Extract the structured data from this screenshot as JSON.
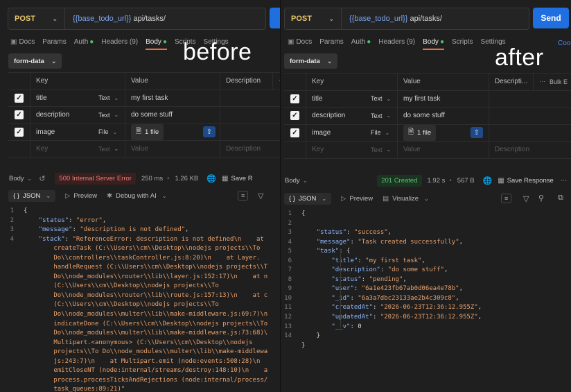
{
  "left": {
    "method": "POST",
    "url_var": "{{base_todo_url}}",
    "url_path": " api/tasks/",
    "send_label": "S",
    "tabs": [
      "Docs",
      "Params",
      "Auth",
      "Headers (9)",
      "Body",
      "Scripts",
      "Settings"
    ],
    "body_mode": "form-data",
    "table_headers": [
      "Key",
      "Value",
      "Description"
    ],
    "rows": [
      {
        "key": "title",
        "type": "Text",
        "value": "my first task"
      },
      {
        "key": "description",
        "type": "Text",
        "value": "do some stuff"
      },
      {
        "key": "image",
        "type": "File",
        "value": "1 file"
      }
    ],
    "placeholder": {
      "key": "Key",
      "type": "Text",
      "value": "Value",
      "desc": "Description"
    },
    "response": {
      "label": "Body",
      "status": "500 Internal Server Error",
      "time": "250 ms",
      "size": "1.26 KB",
      "save": "Save R"
    },
    "view": {
      "format": "JSON",
      "preview": "Preview",
      "extra": "Debug with AI"
    },
    "code": [
      [
        [
          "t",
          "{"
        ]
      ],
      [
        [
          "t",
          "    "
        ],
        [
          "k",
          "\"status\""
        ],
        [
          "t",
          ": "
        ],
        [
          "s",
          "\"error\""
        ],
        [
          "t",
          ","
        ]
      ],
      [
        [
          "t",
          "    "
        ],
        [
          "k",
          "\"message\""
        ],
        [
          "t",
          ": "
        ],
        [
          "s",
          "\"description is not defined\""
        ],
        [
          "t",
          ","
        ]
      ],
      [
        [
          "t",
          "    "
        ],
        [
          "k",
          "\"stack\""
        ],
        [
          "t",
          ": "
        ],
        [
          "s",
          "\"ReferenceError: description is not defined\\n    at"
        ]
      ],
      [
        [
          "s",
          "        createTask (C:\\\\Users\\\\cm\\\\Desktop\\\\nodejs projects\\\\To"
        ]
      ],
      [
        [
          "s",
          "        Do\\\\controllers\\\\taskController.js:8:20)\\n    at Layer."
        ]
      ],
      [
        [
          "s",
          "        handleRequest (C:\\\\Users\\\\cm\\\\Desktop\\\\nodejs projects\\\\T"
        ]
      ],
      [
        [
          "s",
          "        Do\\\\node_modules\\\\router\\\\lib\\\\layer.js:152:17)\\n    at n"
        ]
      ],
      [
        [
          "s",
          "        (C:\\\\Users\\\\cm\\\\Desktop\\\\nodejs projects\\\\To"
        ]
      ],
      [
        [
          "s",
          "        Do\\\\node_modules\\\\router\\\\lib\\\\route.js:157:13)\\n    at c"
        ]
      ],
      [
        [
          "s",
          "        (C:\\\\Users\\\\cm\\\\Desktop\\\\nodejs projects\\\\To"
        ]
      ],
      [
        [
          "s",
          "        Do\\\\node_modules\\\\multer\\\\lib\\\\make-middleware.js:69:7)\\n"
        ]
      ],
      [
        [
          "s",
          "        indicateDone (C:\\\\Users\\\\cm\\\\Desktop\\\\nodejs projects\\\\To"
        ]
      ],
      [
        [
          "s",
          "        Do\\\\node_modules\\\\multer\\\\lib\\\\make-middleware.js:73:68)\\"
        ]
      ],
      [
        [
          "s",
          "        Multipart.<anonymous> (C:\\\\Users\\\\cm\\\\Desktop\\\\nodejs"
        ]
      ],
      [
        [
          "s",
          "        projects\\\\To Do\\\\node_modules\\\\multer\\\\lib\\\\make-middlewa"
        ]
      ],
      [
        [
          "s",
          "        js:243:7)\\n    at Multipart.emit (node:events:508:28)\\n"
        ]
      ],
      [
        [
          "s",
          "        emitCloseNT (node:internal/streams/destroy:148:10)\\n    a"
        ]
      ],
      [
        [
          "s",
          "        process.processTicksAndRejections (node:internal/process/"
        ]
      ],
      [
        [
          "s",
          "        task_queues:89:21)\""
        ]
      ]
    ],
    "line_numbers": [
      "1",
      "2",
      "3",
      "4",
      "",
      "",
      "",
      "",
      "",
      "",
      "",
      "",
      "",
      "",
      "",
      "",
      "",
      "",
      "",
      ""
    ]
  },
  "right": {
    "method": "POST",
    "url_var": "{{base_todo_url}}",
    "url_path": " api/tasks/",
    "send_label": "Send",
    "tabs": [
      "Docs",
      "Params",
      "Auth",
      "Headers (9)",
      "Body",
      "Scripts",
      "Settings"
    ],
    "cookies_label": "Cook",
    "body_mode": "form-data",
    "table_headers": [
      "Key",
      "Value",
      "Descripti...",
      "Bulk E"
    ],
    "rows": [
      {
        "key": "title",
        "type": "Text",
        "value": "my first task"
      },
      {
        "key": "description",
        "type": "Text",
        "value": "do some stuff"
      },
      {
        "key": "image",
        "type": "File",
        "value": "1 file"
      }
    ],
    "placeholder": {
      "key": "Key",
      "type": "Text",
      "value": "Value",
      "desc": "Description"
    },
    "response": {
      "label": "Body",
      "status": "201 Created",
      "time": "1.92 s",
      "size": "567 B",
      "save": "Save Response"
    },
    "view": {
      "format": "JSON",
      "preview": "Preview",
      "extra": "Visualize"
    },
    "code": [
      [
        [
          "t",
          "{"
        ]
      ],
      [
        [
          "t",
          ""
        ]
      ],
      [
        [
          "t",
          "    "
        ],
        [
          "k",
          "\"status\""
        ],
        [
          "t",
          ": "
        ],
        [
          "s",
          "\"success\""
        ],
        [
          "t",
          ","
        ]
      ],
      [
        [
          "t",
          "    "
        ],
        [
          "k",
          "\"message\""
        ],
        [
          "t",
          ": "
        ],
        [
          "s",
          "\"Task created successfully\""
        ],
        [
          "t",
          ","
        ]
      ],
      [
        [
          "t",
          "    "
        ],
        [
          "k",
          "\"task\""
        ],
        [
          "t",
          ": {"
        ]
      ],
      [
        [
          "t",
          "        "
        ],
        [
          "k",
          "\"title\""
        ],
        [
          "t",
          ": "
        ],
        [
          "s",
          "\"my first task\""
        ],
        [
          "t",
          ","
        ]
      ],
      [
        [
          "t",
          "        "
        ],
        [
          "k",
          "\"description\""
        ],
        [
          "t",
          ": "
        ],
        [
          "s",
          "\"do some stuff\""
        ],
        [
          "t",
          ","
        ]
      ],
      [
        [
          "t",
          "        "
        ],
        [
          "k",
          "\"status\""
        ],
        [
          "t",
          ": "
        ],
        [
          "s",
          "\"pending\""
        ],
        [
          "t",
          ","
        ]
      ],
      [
        [
          "t",
          "        "
        ],
        [
          "k",
          "\"user\""
        ],
        [
          "t",
          ": "
        ],
        [
          "s",
          "\"6a1e423fb67ab0d06ea4e78b\""
        ],
        [
          "t",
          ","
        ]
      ],
      [
        [
          "t",
          "        "
        ],
        [
          "k",
          "\"_id\""
        ],
        [
          "t",
          ": "
        ],
        [
          "s",
          "\"6a3a7dbc23133ae2b4c309c8\""
        ],
        [
          "t",
          ","
        ]
      ],
      [
        [
          "t",
          "        "
        ],
        [
          "k",
          "\"createdAt\""
        ],
        [
          "t",
          ": "
        ],
        [
          "s",
          "\"2026-06-23T12:36:12.955Z\""
        ],
        [
          "t",
          ","
        ]
      ],
      [
        [
          "t",
          "        "
        ],
        [
          "k",
          "\"updatedAt\""
        ],
        [
          "t",
          ": "
        ],
        [
          "s",
          "\"2026-06-23T12:36:12.955Z\""
        ],
        [
          "t",
          ","
        ]
      ],
      [
        [
          "t",
          "        "
        ],
        [
          "k",
          "\"__v\""
        ],
        [
          "t",
          ": "
        ],
        [
          "n",
          "0"
        ]
      ],
      [
        [
          "t",
          "    }"
        ]
      ],
      [
        [
          "t",
          "}"
        ]
      ]
    ],
    "line_numbers": [
      "1",
      "2",
      "3",
      "4",
      "5",
      "6",
      "7",
      "8",
      "9",
      "10",
      "11",
      "12",
      "13",
      "14",
      ""
    ]
  },
  "captions": {
    "before": "before",
    "after": "after"
  }
}
